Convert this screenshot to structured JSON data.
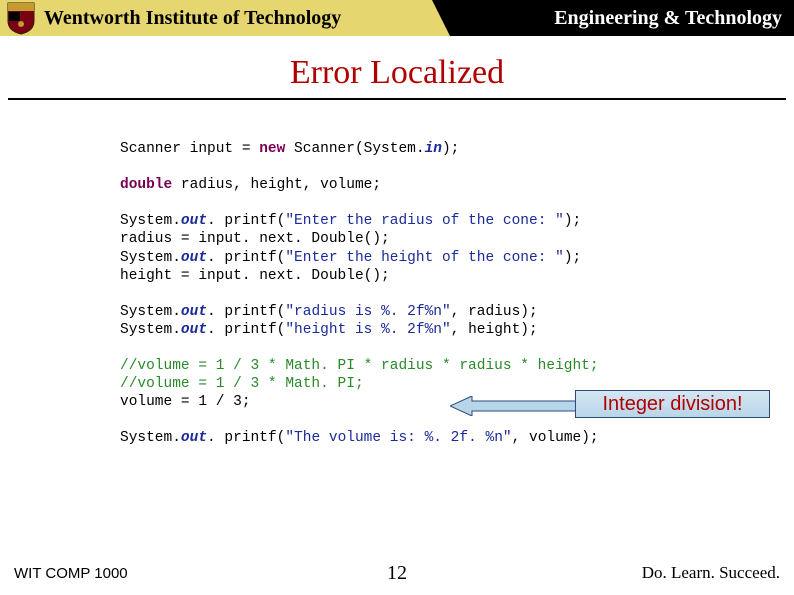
{
  "header": {
    "left_text": "Wentworth Institute of Technology",
    "right_text": "Engineering & Technology"
  },
  "title": "Error Localized",
  "code": {
    "l1a": "Scanner input = ",
    "l1_kw": "new",
    "l1b": " Scanner(System.",
    "l1_field": "in",
    "l1c": ");",
    "l2_kw": "double",
    "l2a": " radius, height, volume;",
    "l3a": "System.",
    "l3_field": "out",
    "l3b": ". printf(",
    "l3_str": "\"Enter the radius of the cone: \"",
    "l3c": ");",
    "l4": "radius = input. next. Double();",
    "l5a": "System.",
    "l5_field": "out",
    "l5b": ". printf(",
    "l5_str": "\"Enter the height of the cone: \"",
    "l5c": ");",
    "l6": "height = input. next. Double();",
    "l7a": "System.",
    "l7_field": "out",
    "l7b": ". printf(",
    "l7_str": "\"radius is %. 2f%n\"",
    "l7c": ", radius);",
    "l8a": "System.",
    "l8_field": "out",
    "l8b": ". printf(",
    "l8_str": "\"height is %. 2f%n\"",
    "l8c": ", height);",
    "l9_cmt": "//volume = 1 / 3 * Math. PI * radius * radius * height;",
    "l10_cmt": "//volume = 1 / 3 * Math. PI;",
    "l11": "volume = 1 / 3;",
    "l12a": "System.",
    "l12_field": "out",
    "l12b": ". printf(",
    "l12_str": "\"The volume is: %. 2f. %n\"",
    "l12c": ", volume);"
  },
  "callout": "Integer division!",
  "footer": {
    "left": "WIT COMP 1000",
    "center": "12",
    "right": "Do. Learn. Succeed."
  }
}
